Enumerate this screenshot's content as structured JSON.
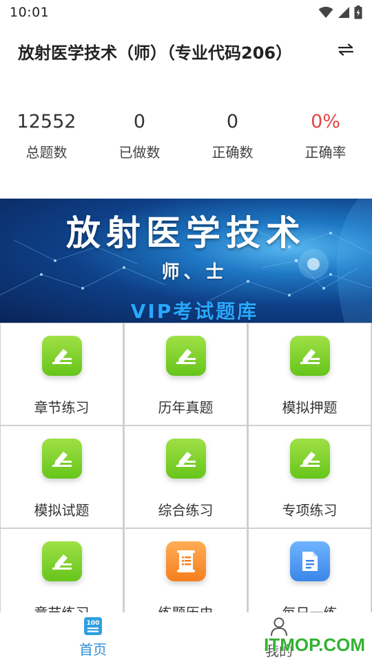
{
  "status_bar": {
    "time": "10:01"
  },
  "header": {
    "title": "放射医学技术（师）（专业代码206）",
    "switch_icon": "swap-arrows-icon"
  },
  "stats": [
    {
      "value": "12552",
      "label": "总题数"
    },
    {
      "value": "0",
      "label": "已做数"
    },
    {
      "value": "0",
      "label": "正确数"
    },
    {
      "value": "0%",
      "label": "正确率",
      "color": "#e34545"
    }
  ],
  "banner": {
    "title": "放射医学技术",
    "subtitle": "师、士",
    "tagline": "VIP考试题库"
  },
  "grid": {
    "items": [
      {
        "label": "章节练习",
        "icon": "pencil-icon",
        "color": "green"
      },
      {
        "label": "历年真题",
        "icon": "pencil-icon",
        "color": "green"
      },
      {
        "label": "模拟押题",
        "icon": "pencil-icon",
        "color": "green"
      },
      {
        "label": "模拟试题",
        "icon": "pencil-icon",
        "color": "green"
      },
      {
        "label": "综合练习",
        "icon": "pencil-icon",
        "color": "green"
      },
      {
        "label": "专项练习",
        "icon": "pencil-icon",
        "color": "green"
      },
      {
        "label": "章节练习",
        "icon": "pencil-icon",
        "color": "green"
      },
      {
        "label": "练题历史",
        "icon": "scroll-icon",
        "color": "orange"
      },
      {
        "label": "每日一练",
        "icon": "document-icon",
        "color": "blue"
      }
    ]
  },
  "tabbar": {
    "tabs": [
      {
        "label": "首页",
        "icon": "score-100-icon",
        "active": true
      },
      {
        "label": "我的",
        "icon": "person-icon",
        "active": false
      }
    ]
  },
  "watermark": "ITMOP.COM",
  "colors": {
    "accent": "#2f8fd6",
    "green": "#66c51a",
    "red": "#e34545"
  }
}
